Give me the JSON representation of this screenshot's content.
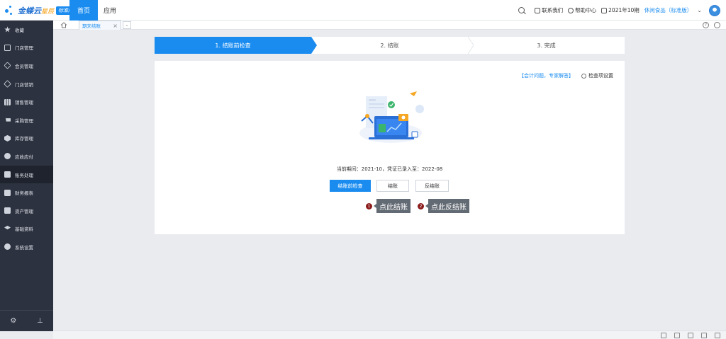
{
  "header": {
    "logo_text": "金蝶云",
    "logo_sub": "星辰",
    "logo_badge": "标准版",
    "nav_home": "首页",
    "nav_apps": "应用",
    "contact": "联系我们",
    "help_center": "帮助中心",
    "period": "2021年10期",
    "company": "休闲食品（标准版）"
  },
  "sidebar": {
    "items": [
      {
        "label": "收藏",
        "icon": "star-icon"
      },
      {
        "label": "门店管理",
        "icon": "store-icon"
      },
      {
        "label": "会员管理",
        "icon": "member-icon"
      },
      {
        "label": "门店营销",
        "icon": "tag-icon"
      },
      {
        "label": "销售管理",
        "icon": "bar-chart-icon"
      },
      {
        "label": "采购管理",
        "icon": "cart-icon"
      },
      {
        "label": "库存管理",
        "icon": "box-icon"
      },
      {
        "label": "应收应付",
        "icon": "money-icon"
      },
      {
        "label": "账务处理",
        "icon": "ledger-icon"
      },
      {
        "label": "财务报表",
        "icon": "report-icon"
      },
      {
        "label": "资产管理",
        "icon": "asset-icon"
      },
      {
        "label": "基础资料",
        "icon": "layers-icon"
      },
      {
        "label": "系统设置",
        "icon": "gear-icon"
      }
    ],
    "active_index": 8
  },
  "tabs": {
    "active_label": "期末结账"
  },
  "steps": {
    "step1": "1. 结账前检查",
    "step2": "2. 结账",
    "step3": "3. 完成"
  },
  "panel": {
    "help_link": "【会计问题，专家解答】",
    "check_settings": "检查项设置",
    "period_text": "当前期间：2021-10，凭证已录入至：2022-08",
    "btn_check": "结账前检查",
    "btn_close": "结账",
    "btn_reverse": "反结账"
  },
  "annotations": {
    "a1_num": "1",
    "a1_text": "点此结账",
    "a2_num": "2",
    "a2_text": "点此反结账"
  },
  "colors": {
    "primary": "#1a8cf0",
    "sidebar_bg": "#2d3240",
    "annotation_bg": "#626a73",
    "annotation_num": "#8b1b1b"
  }
}
